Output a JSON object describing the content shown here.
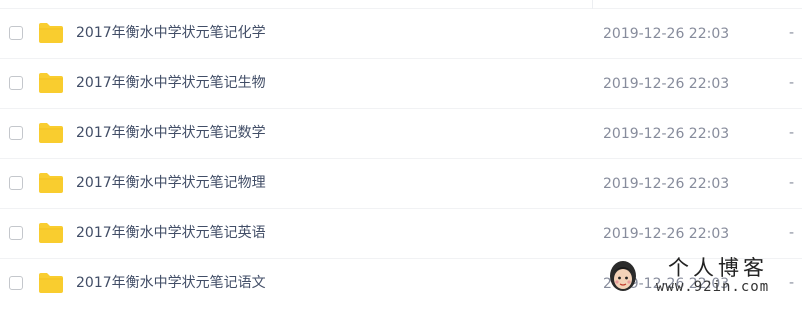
{
  "files": [
    {
      "name": "2017年衡水中学状元笔记化学",
      "modified": "2019-12-26 22:03",
      "size": "-"
    },
    {
      "name": "2017年衡水中学状元笔记生物",
      "modified": "2019-12-26 22:03",
      "size": "-"
    },
    {
      "name": "2017年衡水中学状元笔记数学",
      "modified": "2019-12-26 22:03",
      "size": "-"
    },
    {
      "name": "2017年衡水中学状元笔记物理",
      "modified": "2019-12-26 22:03",
      "size": "-"
    },
    {
      "name": "2017年衡水中学状元笔记英语",
      "modified": "2019-12-26 22:03",
      "size": "-"
    },
    {
      "name": "2017年衡水中学状元笔记语文",
      "modified": "2019-12-26 22:03",
      "size": "-"
    }
  ],
  "icons": {
    "folder": "folder-icon",
    "checkbox": "checkbox"
  },
  "colors": {
    "folder": "#f9cd2f",
    "file_name": "#424e67",
    "meta_text": "#878c9c",
    "divider": "#f1f2f4"
  },
  "watermark": {
    "title": "个人博客",
    "url": "www.92in.com"
  }
}
